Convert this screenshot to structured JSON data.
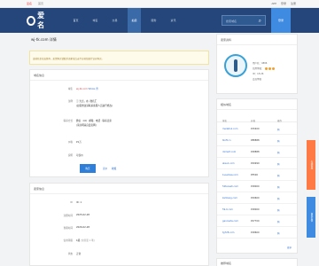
{
  "topbar": {
    "links": [
      "爱名",
      "首页"
    ],
    "right": [
      "APP",
      "登录",
      "注册"
    ]
  },
  "nav": {
    "logo": "爱名",
    "menu": [
      "首页",
      "域名",
      "交易",
      "拍卖",
      "服务",
      "资讯"
    ],
    "active_index": 3,
    "search_placeholder": "搜索域名",
    "login": "登录"
  },
  "page": {
    "breadcrumb": "wj-tk.com 详情",
    "notice": "该域名正在出售中，如需购买请联系卖家或点击下方按钮进行议价购买。"
  },
  "domain_info": {
    "title": "域名信息",
    "rows": [
      {
        "label": "域名",
        "value": "wj-tk.com",
        "extra1": "Whois",
        "extra2": "查"
      },
      {
        "label": "注释",
        "value": "ⓘ 光点，在, 微名汇",
        "value2": "(如需修改请联系客服人员进行修改)"
      },
      {
        "label": "联系方式",
        "value": "微信 · QQ · 邮箱 · 电话 · 联系卖家",
        "value2": "(请注明来自爱名网)"
      },
      {
        "label": "价格",
        "value": "¥1万"
      },
      {
        "label": "说明",
        "value": "可议价"
      },
      {
        "label": "",
        "button": "购买",
        "link1": "议价",
        "link2": "收藏"
      }
    ]
  },
  "seller_info": {
    "title": "卖家信息",
    "rows": [
      {
        "label": "ID",
        "value": "ID: 1"
      },
      {
        "label": "注册时间",
        "value": "2025-02-28"
      },
      {
        "label": "到期时间",
        "value": "2026-02-28"
      },
      {
        "label": "信用等级",
        "value": "1级",
        "value2": "(交易量 1 笔)"
      },
      {
        "label": "状态",
        "value": "正常"
      }
    ]
  },
  "user_card": {
    "title": "卖家资料",
    "lines": [
      "用户名：4896",
      "信用等级：",
      "ID：15:26",
      "会员等级"
    ]
  },
  "similar": {
    "title": "相似域名",
    "headers": [
      "域名",
      "价格",
      "操作"
    ],
    "rows": [
      {
        "domain": "medatu1.com",
        "price": "¥15400",
        "action": "购"
      },
      {
        "domain": "tkoft.cn",
        "price": "¥88888",
        "action": "购"
      },
      {
        "domain": "dxmart.com",
        "price": "¥28888",
        "action": "购"
      },
      {
        "domain": "aksu1.com",
        "price": "¥29999",
        "action": "购"
      },
      {
        "domain": "1userkaa.com",
        "price": "¥5500",
        "action": "购"
      },
      {
        "domain": "52tanasti.com",
        "price": "¥18000",
        "action": "购"
      },
      {
        "domain": "kamlang.com",
        "price": "¥29600",
        "action": "购"
      },
      {
        "domain": "59-0.com",
        "price": "¥18000",
        "action": "购"
      },
      {
        "domain": "gancashs.com",
        "price": "¥27700",
        "action": "购"
      },
      {
        "domain": "tg728.com",
        "price": "¥18600",
        "action": "购"
      }
    ],
    "more": "更多"
  },
  "bottom_card": {
    "title": "推荐域名"
  },
  "floats": {
    "orange": "在线客服",
    "blue": "意见反馈"
  },
  "colors": {
    "nav": "#24467a",
    "accent": "#3f8be2",
    "price": "#e4393c",
    "float_orange": "#ff7a45"
  }
}
